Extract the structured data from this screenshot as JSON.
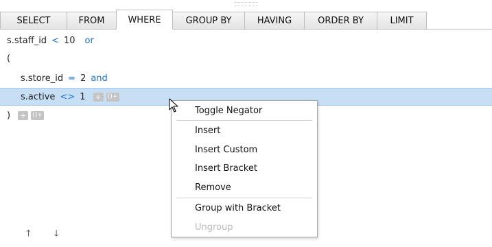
{
  "tabs": [
    "SELECT",
    "FROM",
    "WHERE",
    "GROUP BY",
    "HAVING",
    "ORDER BY",
    "LIMIT"
  ],
  "active_tab": "WHERE",
  "conditions": {
    "line1": {
      "ident": "s.staff_id",
      "op": "<",
      "value": "10",
      "conj": "or"
    },
    "open_paren": "(",
    "line2": {
      "ident": "s.store_id",
      "op": "=",
      "value": "2",
      "conj": "and"
    },
    "line3": {
      "ident": "s.active",
      "op": "<>",
      "value": "1"
    },
    "close_paren": ")"
  },
  "mini_buttons": {
    "add": "+",
    "bracket": "()+"
  },
  "bottom": {
    "up": "🡑",
    "down": "🡓"
  },
  "context_menu": {
    "toggle_negator": "Toggle Negator",
    "insert": "Insert",
    "insert_custom": "Insert Custom",
    "insert_bracket": "Insert Bracket",
    "remove": "Remove",
    "group_with_bracket": "Group with Bracket",
    "ungroup": "Ungroup"
  },
  "colors": {
    "selection": "#c7dff5",
    "keyword": "#1e6fd9"
  }
}
